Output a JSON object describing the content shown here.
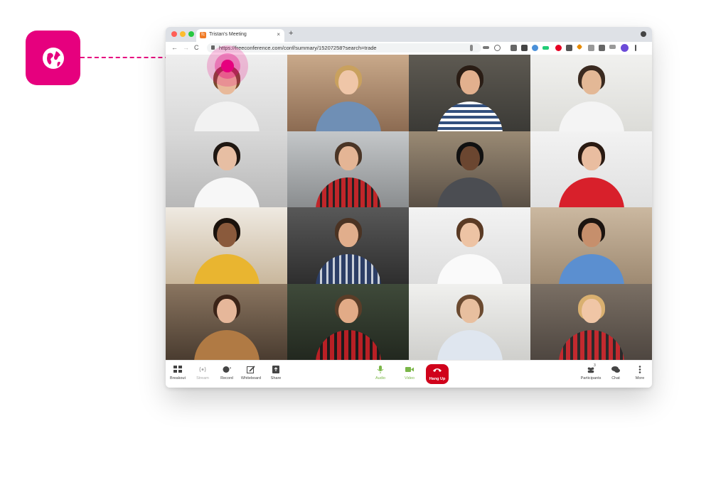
{
  "colors": {
    "brand": "#e6007e",
    "hangup": "#d0021b",
    "audio": "#7ab648"
  },
  "badge": {
    "icon": "globe-icon"
  },
  "browser": {
    "tab_title": "Tristan's Meeting",
    "tab_close": "×",
    "new_tab": "+",
    "nav_back": "←",
    "nav_forward": "→",
    "nav_reload": "C",
    "url": "https://freeconference.com/conf/summary/15207258?search=trade"
  },
  "participants_grid": [
    {
      "name": "participant-1"
    },
    {
      "name": "participant-2"
    },
    {
      "name": "participant-3"
    },
    {
      "name": "participant-4"
    },
    {
      "name": "participant-5"
    },
    {
      "name": "participant-6"
    },
    {
      "name": "participant-7"
    },
    {
      "name": "participant-8"
    },
    {
      "name": "participant-9"
    },
    {
      "name": "participant-10"
    },
    {
      "name": "participant-11"
    },
    {
      "name": "participant-12"
    },
    {
      "name": "participant-13"
    },
    {
      "name": "participant-14"
    },
    {
      "name": "participant-15"
    },
    {
      "name": "participant-16"
    }
  ],
  "controls": {
    "breakout": "Breakout",
    "stream": "Stream",
    "record": "Record",
    "whiteboard": "Whiteboard",
    "share": "Share",
    "audio": "Audio",
    "video": "Video",
    "hangup": "Hang Up",
    "participants": "Participants",
    "participants_count": "3",
    "chat": "Chat",
    "more": "More"
  }
}
